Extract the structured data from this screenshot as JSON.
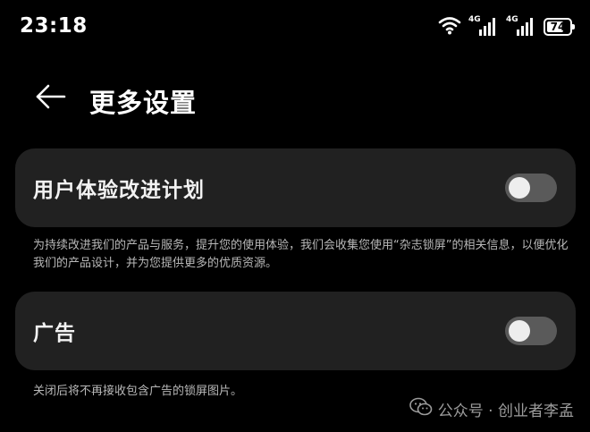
{
  "status_bar": {
    "time": "23:18",
    "signal1_tag": "4G",
    "signal2_tag": "4G",
    "battery_level": "74",
    "battery_fraction": 0.74
  },
  "header": {
    "title": "更多设置"
  },
  "settings": [
    {
      "label": "用户体验改进计划",
      "enabled": false,
      "note": "为持续改进我们的产品与服务，提升您的使用体验，我们会收集您使用“杂志锁屏”的相关信息，以便优化我们的产品设计，并为您提供更多的优质资源。"
    },
    {
      "label": "广告",
      "enabled": false,
      "note": "关闭后将不再接收包含广告的锁屏图片。"
    }
  ],
  "watermark": {
    "text": "公众号 · 创业者李孟"
  },
  "colors": {
    "background": "#000000",
    "card": "#212121",
    "toggle_track_off": "#5a5a5a",
    "toggle_knob": "#eeeeee",
    "note_text": "#b8b8b8"
  },
  "icons": {
    "back": "back-arrow-icon",
    "wifi": "wifi-icon",
    "signal": "signal-icon",
    "battery": "battery-icon",
    "watermark_logo": "wechat-icon"
  }
}
